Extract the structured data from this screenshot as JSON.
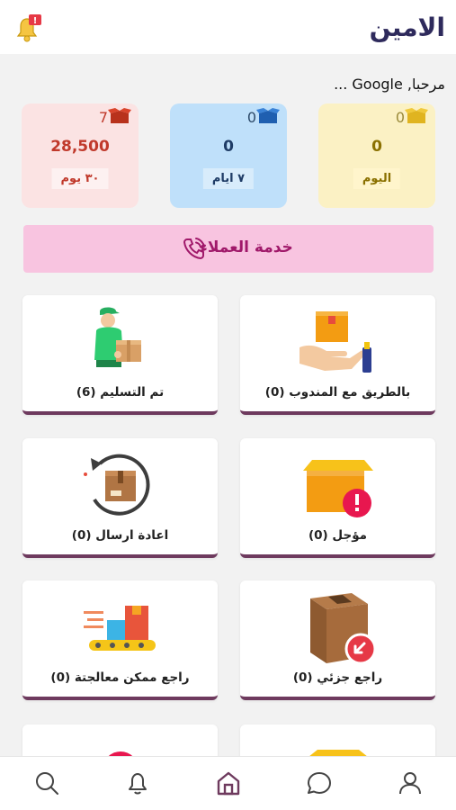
{
  "header": {
    "title": "الامين",
    "notification_badge": "!"
  },
  "greeting": "مرحبا, Google ...",
  "stats": [
    {
      "id": "today",
      "count": "0",
      "value": "0",
      "period": "اليوم"
    },
    {
      "id": "week",
      "count": "0",
      "value": "0",
      "period": "٧ ايام"
    },
    {
      "id": "month",
      "count": "7",
      "value": "28,500",
      "period": "٣٠ يوم"
    }
  ],
  "support": {
    "label": "خدمة العملاء",
    "icon": "phone-icon"
  },
  "tiles": [
    {
      "id": "with-courier",
      "label": "بالطريق مع المندوب (0)",
      "icon": "box-in-hand-icon"
    },
    {
      "id": "delivered",
      "label": "تم التسليم (6)",
      "icon": "courier-with-box-icon"
    },
    {
      "id": "postponed",
      "label": "مؤجل (0)",
      "icon": "box-alert-icon"
    },
    {
      "id": "resend",
      "label": "اعادة ارسال (0)",
      "icon": "box-return-arrow-icon"
    },
    {
      "id": "partial-return",
      "label": "راجع جزئي (0)",
      "icon": "box-return-badge-icon"
    },
    {
      "id": "returnable",
      "label": "راجع ممكن معالجتة (0)",
      "icon": "conveyor-boxes-icon"
    },
    {
      "id": "more-1",
      "label": "",
      "icon": "box-icon"
    },
    {
      "id": "more-2",
      "label": "",
      "icon": "badge-icon"
    }
  ],
  "nav": [
    "search-icon",
    "bell-icon",
    "home-icon",
    "chat-icon",
    "user-icon"
  ],
  "colors": {
    "brand": "#2e2a5c",
    "tile_border": "#6e3a5e",
    "support_bg": "#f8c4e0",
    "support_text": "#a0196a"
  }
}
